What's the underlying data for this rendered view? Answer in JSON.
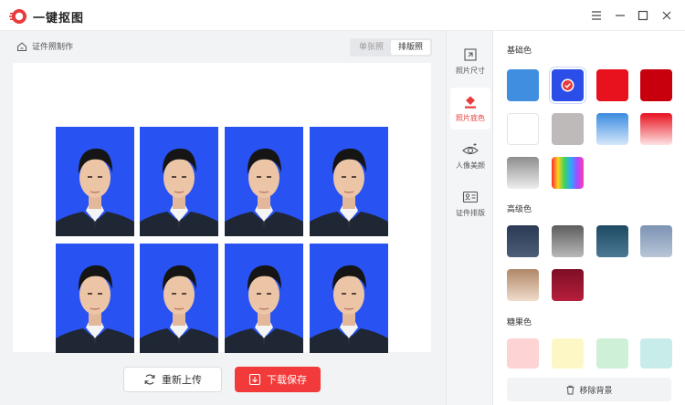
{
  "app": {
    "title": "一键抠图"
  },
  "breadcrumb": {
    "label": "证件照制作"
  },
  "view_toggle": {
    "single": "单张照",
    "layout": "排版照",
    "selected": "排版照"
  },
  "actions": {
    "reupload": "重新上传",
    "download": "下载保存"
  },
  "nav": [
    {
      "label": "照片尺寸",
      "icon": "crop-icon",
      "active": false
    },
    {
      "label": "照片底色",
      "icon": "paint-bucket-icon",
      "active": true
    },
    {
      "label": "人像美颜",
      "icon": "eye-sparkle-icon",
      "active": false
    },
    {
      "label": "证件排版",
      "icon": "id-card-icon",
      "active": false
    }
  ],
  "panel": {
    "basic_title": "基础色",
    "advanced_title": "高级色",
    "candy_title": "糖果色",
    "remove_bg": "移除背景",
    "selected_color": "#2b4ee8",
    "basic_colors": [
      "#3f8ee0",
      "#2b4ee8",
      "#e8121f",
      "#c8000e",
      "#ffffff",
      "#bdbab9",
      "gradient-blue",
      "gradient-red",
      "gradient-gray",
      "rainbow"
    ],
    "advanced_colors": [
      "gradient-navy",
      "gradient-slate",
      "gradient-teal",
      "gradient-steel",
      "gradient-tan",
      "gradient-crimson"
    ],
    "candy_colors": [
      "#fdd3d3",
      "#fdf7c5",
      "#cdf0d6",
      "#c8ecea"
    ]
  },
  "photos": {
    "count": 8,
    "background": "#2852f2"
  }
}
